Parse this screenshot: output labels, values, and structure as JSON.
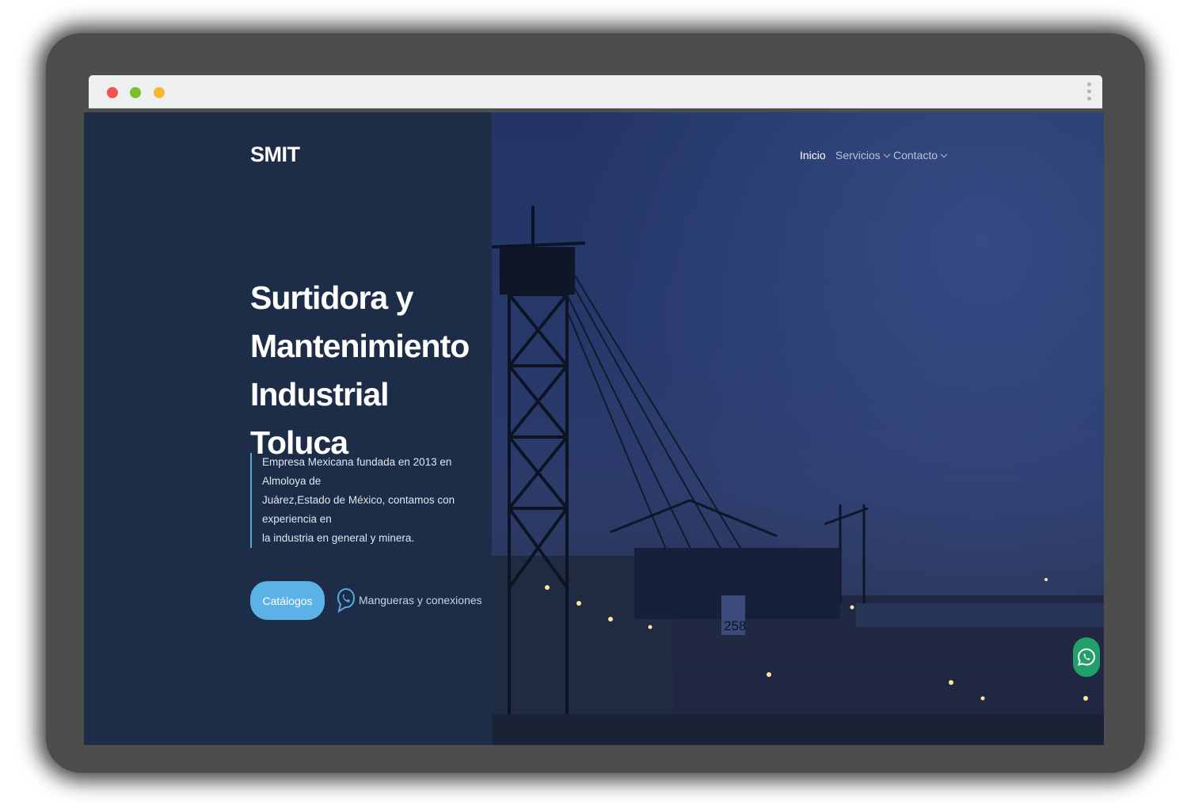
{
  "browser": {
    "window_controls": [
      "close",
      "minimize",
      "maximize"
    ],
    "menu_icon": "kebab-menu-icon"
  },
  "header": {
    "logo": "SMIT",
    "nav": [
      {
        "label": "Inicio",
        "active": true
      },
      {
        "label": "Servicios",
        "dropdown": true
      },
      {
        "label": "Contacto",
        "dropdown": true
      }
    ]
  },
  "hero": {
    "title_lines": [
      "Surtidora y",
      "Mantenimiento",
      "Industrial Toluca"
    ],
    "description_lines": [
      "Empresa Mexicana fundada en 2013 en Almoloya de",
      "Juárez,Estado de México, contamos con experiencia en",
      "la industria en general y minera."
    ],
    "primary_button": "Catálogos",
    "whatsapp_link": "Mangueras y conexiones",
    "image_label": "258"
  },
  "floating": {
    "icon": "whatsapp-icon"
  },
  "colors": {
    "background": "#1d2d48",
    "accent": "#5bb2e6",
    "whatsapp": "#22a06b"
  }
}
